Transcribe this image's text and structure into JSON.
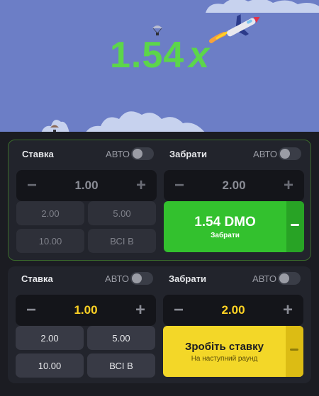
{
  "game": {
    "multiplier_value": "1.54",
    "multiplier_suffix": "x"
  },
  "colors": {
    "accent_green": "#33c12e",
    "accent_yellow": "#f3d728",
    "sky": "#6c7ec6"
  },
  "panel1": {
    "bet": {
      "label": "Ставка",
      "auto_label": "АВТО",
      "auto_on": false,
      "value": "1.00",
      "minus": "−",
      "plus": "+"
    },
    "cashout": {
      "label": "Забрати",
      "auto_label": "АВТО",
      "auto_on": false,
      "value": "2.00",
      "minus": "−",
      "plus": "+"
    },
    "quick_bets": [
      "2.00",
      "5.00",
      "10.00",
      "ВСІ В"
    ],
    "action": {
      "title": "1.54 DMO",
      "subtitle": "Забрати"
    }
  },
  "panel2": {
    "bet": {
      "label": "Ставка",
      "auto_label": "АВТО",
      "auto_on": false,
      "value": "1.00",
      "minus": "−",
      "plus": "+"
    },
    "cashout": {
      "label": "Забрати",
      "auto_label": "АВТО",
      "auto_on": false,
      "value": "2.00",
      "minus": "−",
      "plus": "+"
    },
    "quick_bets": [
      "2.00",
      "5.00",
      "10.00",
      "ВСІ В"
    ],
    "action": {
      "title": "Зробіть ставку",
      "subtitle": "На наступний раунд"
    }
  }
}
